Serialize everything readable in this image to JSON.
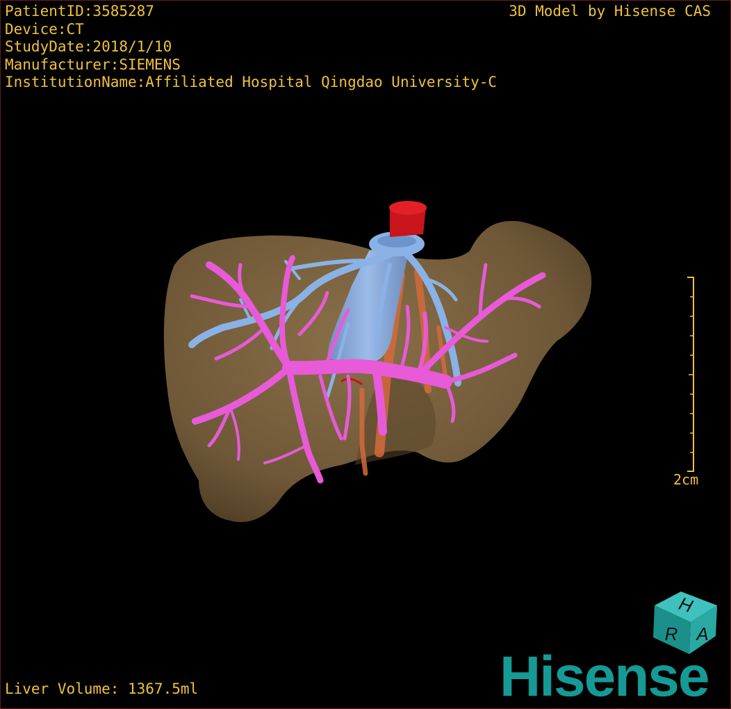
{
  "overlay": {
    "patient_id": "PatientID:3585287",
    "device": "Device:CT",
    "study_date": "StudyDate:2018/1/10",
    "manufacturer": "Manufacturer:SIEMENS",
    "institution": "InstitutionName:Affiliated Hospital Qingdao University-C",
    "credit": "3D Model by Hisense CAS",
    "liver_volume": "Liver Volume: 1367.5ml",
    "scale_label": "2cm"
  },
  "orientation_cube": {
    "letters": [
      "H",
      "R",
      "A"
    ]
  },
  "brand": {
    "name": "Hisense"
  },
  "colors": {
    "text": "#f0c23a",
    "liver": "#7a6240",
    "portal_vein": "#e85ad8",
    "hepatic_vein": "#8ab2e6",
    "artery": "#d11a1a",
    "bile_duct": "#d46a3a",
    "brand": "#159a95"
  }
}
